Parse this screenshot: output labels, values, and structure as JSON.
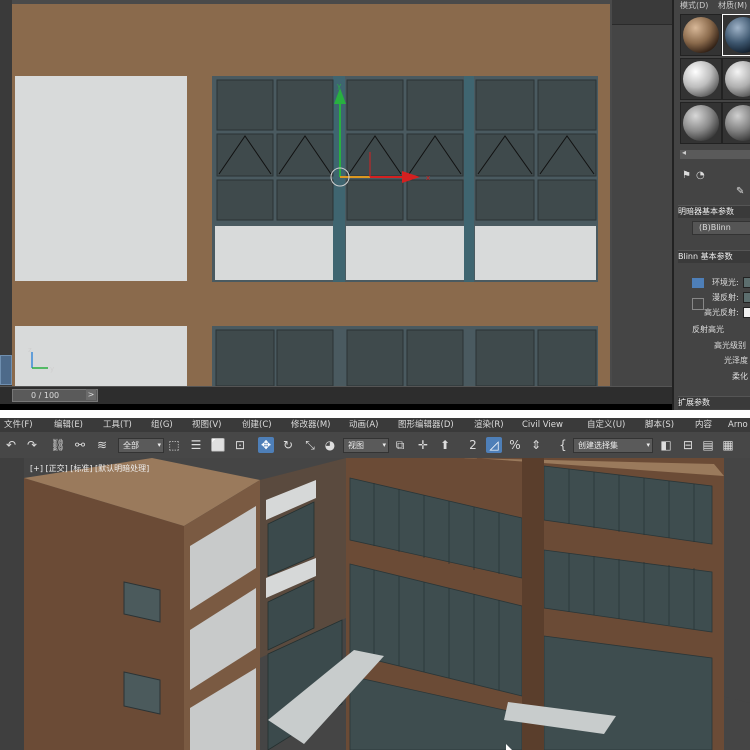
{
  "material_editor": {
    "tabs": [
      "模式(D)",
      "材质(M)"
    ],
    "shader_rollout": "明暗器基本参数",
    "shader": "(B)Blinn",
    "blinn_rollout": "Blinn 基本参数",
    "ambient_label": "环境光:",
    "diffuse_label": "漫反射:",
    "specular_label": "高光反射:",
    "highlights_label": "反射高光",
    "spec_level_label": "高光级别",
    "glossiness_label": "光泽度",
    "soften_label": "柔化",
    "extended_rollout": "扩展参数"
  },
  "timeline": {
    "frame": "0 / 100",
    "arrow": ">"
  },
  "axis": {
    "x": "x",
    "y": "y",
    "z": "z"
  },
  "menu": [
    "文件(F)",
    "编辑(E)",
    "工具(T)",
    "组(G)",
    "视图(V)",
    "创建(C)",
    "修改器(M)",
    "动画(A)",
    "图形编辑器(D)",
    "渲染(R)",
    "Civil View",
    "自定义(U)",
    "脚本(S)",
    "内容",
    "Arno"
  ],
  "toolbar": {
    "selection_filter": "全部",
    "reference_coord": "视图",
    "named_selection": "创建选择集",
    "snap_label": "2",
    "percent_label": "%"
  },
  "viewport_label": "[+] [正交] [标准] [默认明暗处理]",
  "colors": {
    "wall": "#8a6a4c",
    "window_frame": "#4a5a60",
    "glass": "#3f4a4c",
    "panel": "#d8dada",
    "accent": "#4e7fb8"
  }
}
